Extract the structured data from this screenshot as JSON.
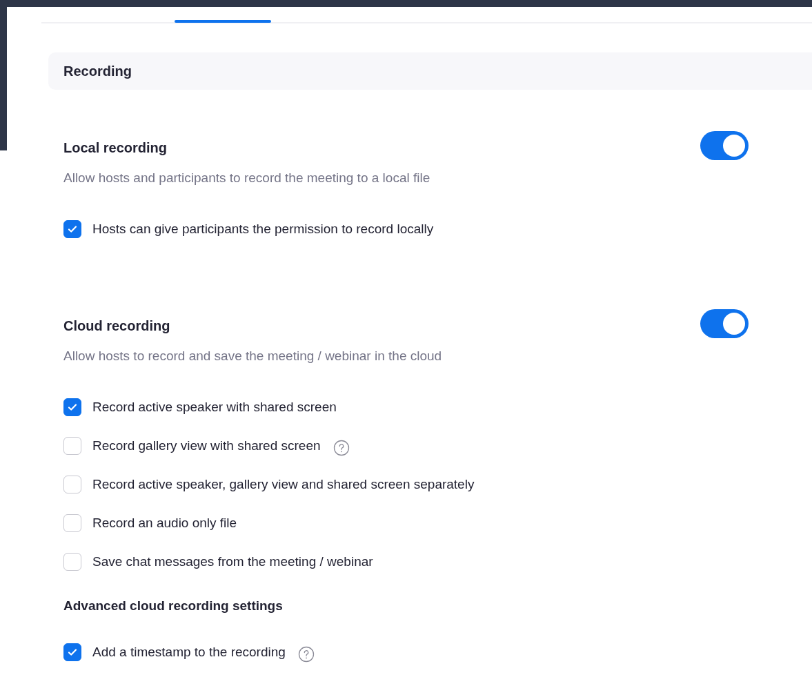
{
  "section_title": "Recording",
  "settings": [
    {
      "title": "Local recording",
      "description": "Allow hosts and participants to record the meeting to a local file",
      "on": true,
      "options": [
        {
          "label": "Hosts can give participants the permission to record locally",
          "checked": true,
          "help": false
        }
      ]
    },
    {
      "title": "Cloud recording",
      "description": "Allow hosts to record and save the meeting / webinar in the cloud",
      "on": true,
      "options": [
        {
          "label": "Record active speaker with shared screen",
          "checked": true,
          "help": false
        },
        {
          "label": "Record gallery view with shared screen",
          "checked": false,
          "help": true
        },
        {
          "label": "Record active speaker, gallery view and shared screen separately",
          "checked": false,
          "help": false
        },
        {
          "label": "Record an audio only file",
          "checked": false,
          "help": false
        },
        {
          "label": "Save chat messages from the meeting / webinar",
          "checked": false,
          "help": false
        }
      ],
      "subsections": [
        {
          "title": "Advanced cloud recording settings",
          "options": [
            {
              "label": "Add a timestamp to the recording",
              "checked": true,
              "help": true
            }
          ]
        }
      ]
    }
  ]
}
